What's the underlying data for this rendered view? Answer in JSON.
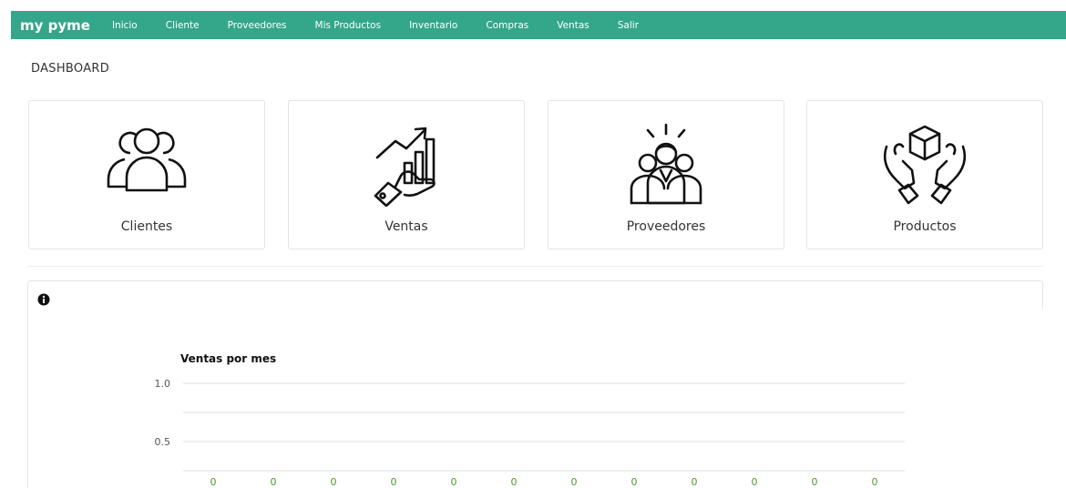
{
  "nav": {
    "brand": "my pyme",
    "items": [
      "Inicio",
      "Cliente",
      "Proveedores",
      "Mis Productos",
      "Inventario",
      "Compras",
      "Ventas",
      "Salir"
    ]
  },
  "page": {
    "title": "DASHBOARD"
  },
  "cards": [
    {
      "label": "Clientes",
      "icon": "users-icon"
    },
    {
      "label": "Ventas",
      "icon": "sales-growth-icon"
    },
    {
      "label": "Proveedores",
      "icon": "suppliers-team-icon"
    },
    {
      "label": "Productos",
      "icon": "product-hands-icon"
    }
  ],
  "colors": {
    "nav": "#34a68a",
    "value_labels": "#4c9a2a"
  },
  "chart_data": {
    "type": "bar",
    "title": "Ventas por mes",
    "yticks": [
      "1.0",
      "0.5"
    ],
    "ylim": [
      0,
      1
    ],
    "grid": true,
    "values": [
      0,
      0,
      0,
      0,
      0,
      0,
      0,
      0,
      0,
      0,
      0,
      0
    ],
    "value_labels": [
      "0",
      "0",
      "0",
      "0",
      "0",
      "0",
      "0",
      "0",
      "0",
      "0",
      "0",
      "0"
    ]
  }
}
